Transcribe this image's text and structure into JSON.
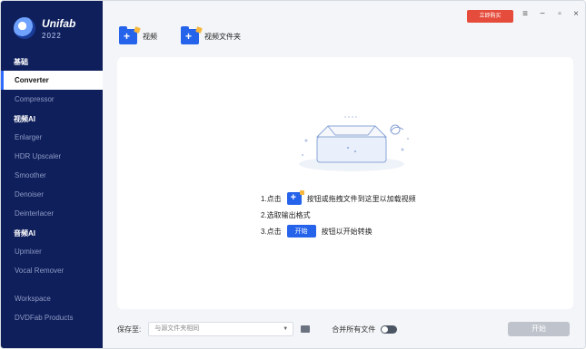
{
  "app": {
    "name": "Unifab",
    "year": "2022"
  },
  "sidebar": {
    "sections": [
      {
        "title": "基础",
        "items": [
          {
            "label": "Converter",
            "active": true
          },
          {
            "label": "Compressor",
            "active": false
          }
        ]
      },
      {
        "title": "视频AI",
        "items": [
          {
            "label": "Enlarger",
            "active": false
          },
          {
            "label": "HDR Upscaler",
            "active": false
          },
          {
            "label": "Smoother",
            "active": false
          },
          {
            "label": "Denoiser",
            "active": false
          },
          {
            "label": "Deinterlacer",
            "active": false
          }
        ]
      },
      {
        "title": "音频AI",
        "items": [
          {
            "label": "Upmixer",
            "active": false
          },
          {
            "label": "Vocal Remover",
            "active": false
          }
        ]
      }
    ],
    "footer_items": [
      {
        "label": "Workspace"
      },
      {
        "label": "DVDFab Products"
      }
    ]
  },
  "toolbar": {
    "add_video_label": "视频",
    "add_folder_label": "视频文件夹",
    "buy_label": "立即购买"
  },
  "window_controls": {
    "menu_icon": "menu-icon",
    "minimize_icon": "minimize-icon",
    "maximize_icon": "maximize-icon",
    "close_icon": "close-icon"
  },
  "instructions": {
    "step1_prefix": "1.点击",
    "step1_suffix": "按钮或拖拽文件到这里以加载视频",
    "step2": "2.选取输出格式",
    "step3_prefix": "3.点击",
    "step3_button": "开始",
    "step3_suffix": "按钮以开始转换"
  },
  "bottom": {
    "save_label": "保存至:",
    "save_value": "与源文件夹相同",
    "merge_label": "合并所有文件",
    "merge_enabled": false,
    "start_label": "开始"
  },
  "colors": {
    "sidebar_bg": "#0f1f5c",
    "accent": "#2563eb",
    "buy": "#e64c3c"
  }
}
